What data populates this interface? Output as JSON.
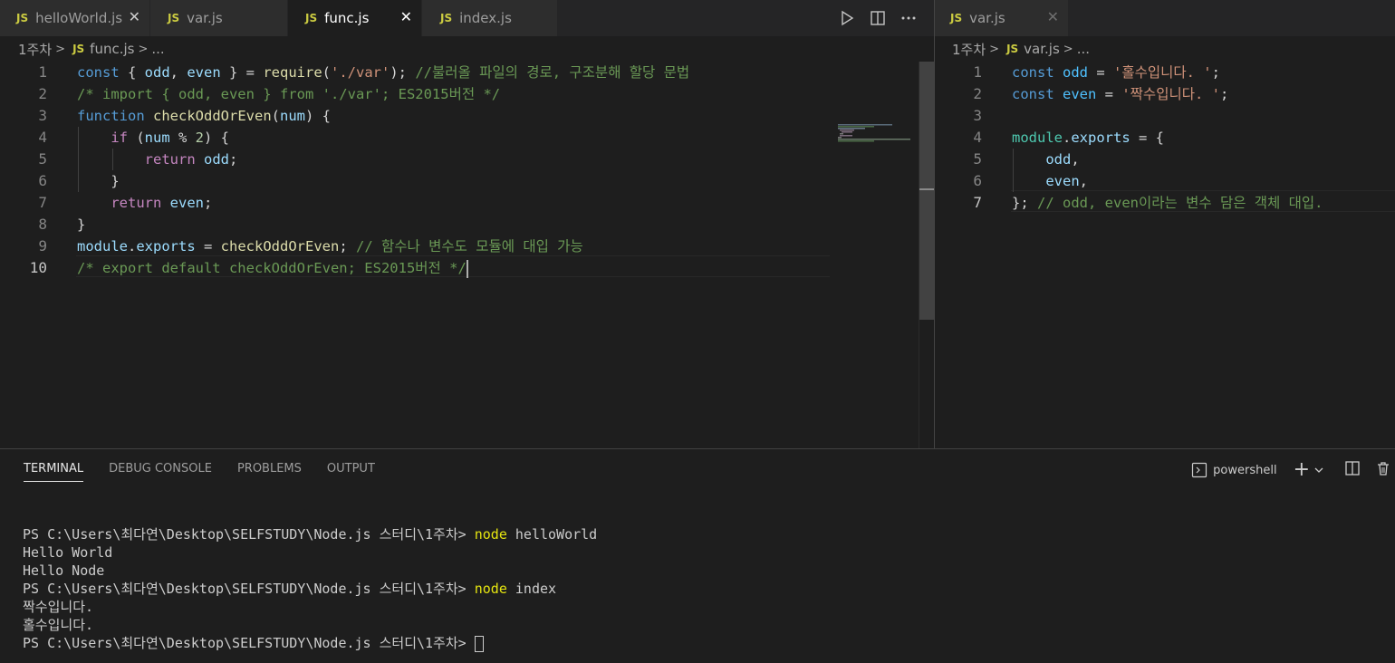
{
  "left_tabs": [
    {
      "icon": "JS",
      "label": "helloWorld.js"
    },
    {
      "icon": "JS",
      "label": "var.js"
    },
    {
      "icon": "JS",
      "label": "func.js"
    },
    {
      "icon": "JS",
      "label": "index.js"
    }
  ],
  "right_tabs": [
    {
      "icon": "JS",
      "label": "var.js"
    }
  ],
  "close_glyph": "✕",
  "left_breadcrumb": {
    "folder": "1주차",
    "icon": "JS",
    "file": "func.js",
    "more": "..."
  },
  "right_breadcrumb": {
    "folder": "1주차",
    "icon": "JS",
    "file": "var.js",
    "more": "..."
  },
  "left_line_numbers": [
    "1",
    "2",
    "3",
    "4",
    "5",
    "6",
    "7",
    "8",
    "9",
    "10"
  ],
  "left_code": {
    "l1": {
      "kw": "const",
      "open": " { ",
      "a": "odd",
      "comma": ", ",
      "b": "even",
      "close": " } = ",
      "fn": "require",
      "po": "(",
      "str": "'./var'",
      "pc": "); ",
      "cm": "//불러올 파일의 경로, 구조분해 할당 문법"
    },
    "l2": {
      "cm": "/* import { odd, even } from './var'; ES2015버전 */"
    },
    "l3": {
      "kw": "function",
      "sp": " ",
      "fn": "checkOddOrEven",
      "po": "(",
      "arg": "num",
      "pc": ") {"
    },
    "l4": {
      "indent": "    ",
      "kw": "if",
      "o": " (",
      "arg": "num",
      "op": " % ",
      "num": "2",
      "c": ") {"
    },
    "l5": {
      "indent": "        ",
      "kw": "return",
      "sp": " ",
      "v": "odd",
      "semi": ";"
    },
    "l6": {
      "text": "    }"
    },
    "l7": {
      "indent": "    ",
      "kw": "return",
      "sp": " ",
      "v": "even",
      "semi": ";"
    },
    "l8": {
      "text": "}"
    },
    "l9": {
      "obj": "module",
      "dot": ".",
      "prop": "exports",
      "eq": " = ",
      "fn": "checkOddOrEven",
      "semi": "; ",
      "cm": "// 함수나 변수도 모듈에 대입 가능"
    },
    "l10": {
      "cm": "/* export default checkOddOrEven; ES2015버전 */"
    }
  },
  "right_line_numbers": [
    "1",
    "2",
    "3",
    "4",
    "5",
    "6",
    "7"
  ],
  "right_code": {
    "l1": {
      "kw": "const",
      "sp": " ",
      "v": "odd",
      "eq": " = ",
      "str": "'홀수입니다. '",
      "semi": ";"
    },
    "l2": {
      "kw": "const",
      "sp": " ",
      "v": "even",
      "eq": " = ",
      "str": "'짝수입니다. '",
      "semi": ";"
    },
    "l4": {
      "obj": "module",
      "dot": ".",
      "prop": "exports",
      "eq": " = {"
    },
    "l5": {
      "indent": "    ",
      "v": "odd",
      "comma": ","
    },
    "l6": {
      "indent": "    ",
      "v": "even",
      "comma": ","
    },
    "l7": {
      "close": "}; ",
      "cm": "// odd, even이라는 변수 담은 객체 대입."
    }
  },
  "terminal": {
    "tabs": [
      "TERMINAL",
      "DEBUG CONSOLE",
      "PROBLEMS",
      "OUTPUT"
    ],
    "shell_label": "powershell",
    "add_glyph": "+",
    "lines": [
      {
        "prompt": "PS C:\\Users\\최다연\\Desktop\\SELFSTUDY\\Node.js 스터디\\1주차> ",
        "cmd": "node",
        "arg": " helloWorld"
      },
      {
        "text": "Hello World"
      },
      {
        "text": "Hello Node"
      },
      {
        "prompt": "PS C:\\Users\\최다연\\Desktop\\SELFSTUDY\\Node.js 스터디\\1주차> ",
        "cmd": "node",
        "arg": " index"
      },
      {
        "text": "짝수입니다."
      },
      {
        "text": "홀수입니다."
      },
      {
        "prompt": "PS C:\\Users\\최다연\\Desktop\\SELFSTUDY\\Node.js 스터디\\1주차> "
      }
    ]
  },
  "colors": {
    "accent_js": "#cbcb41",
    "editor_bg": "#1e1e1e",
    "tab_bg": "#2d2d2d",
    "terminal_cmd": "#e5e510"
  }
}
